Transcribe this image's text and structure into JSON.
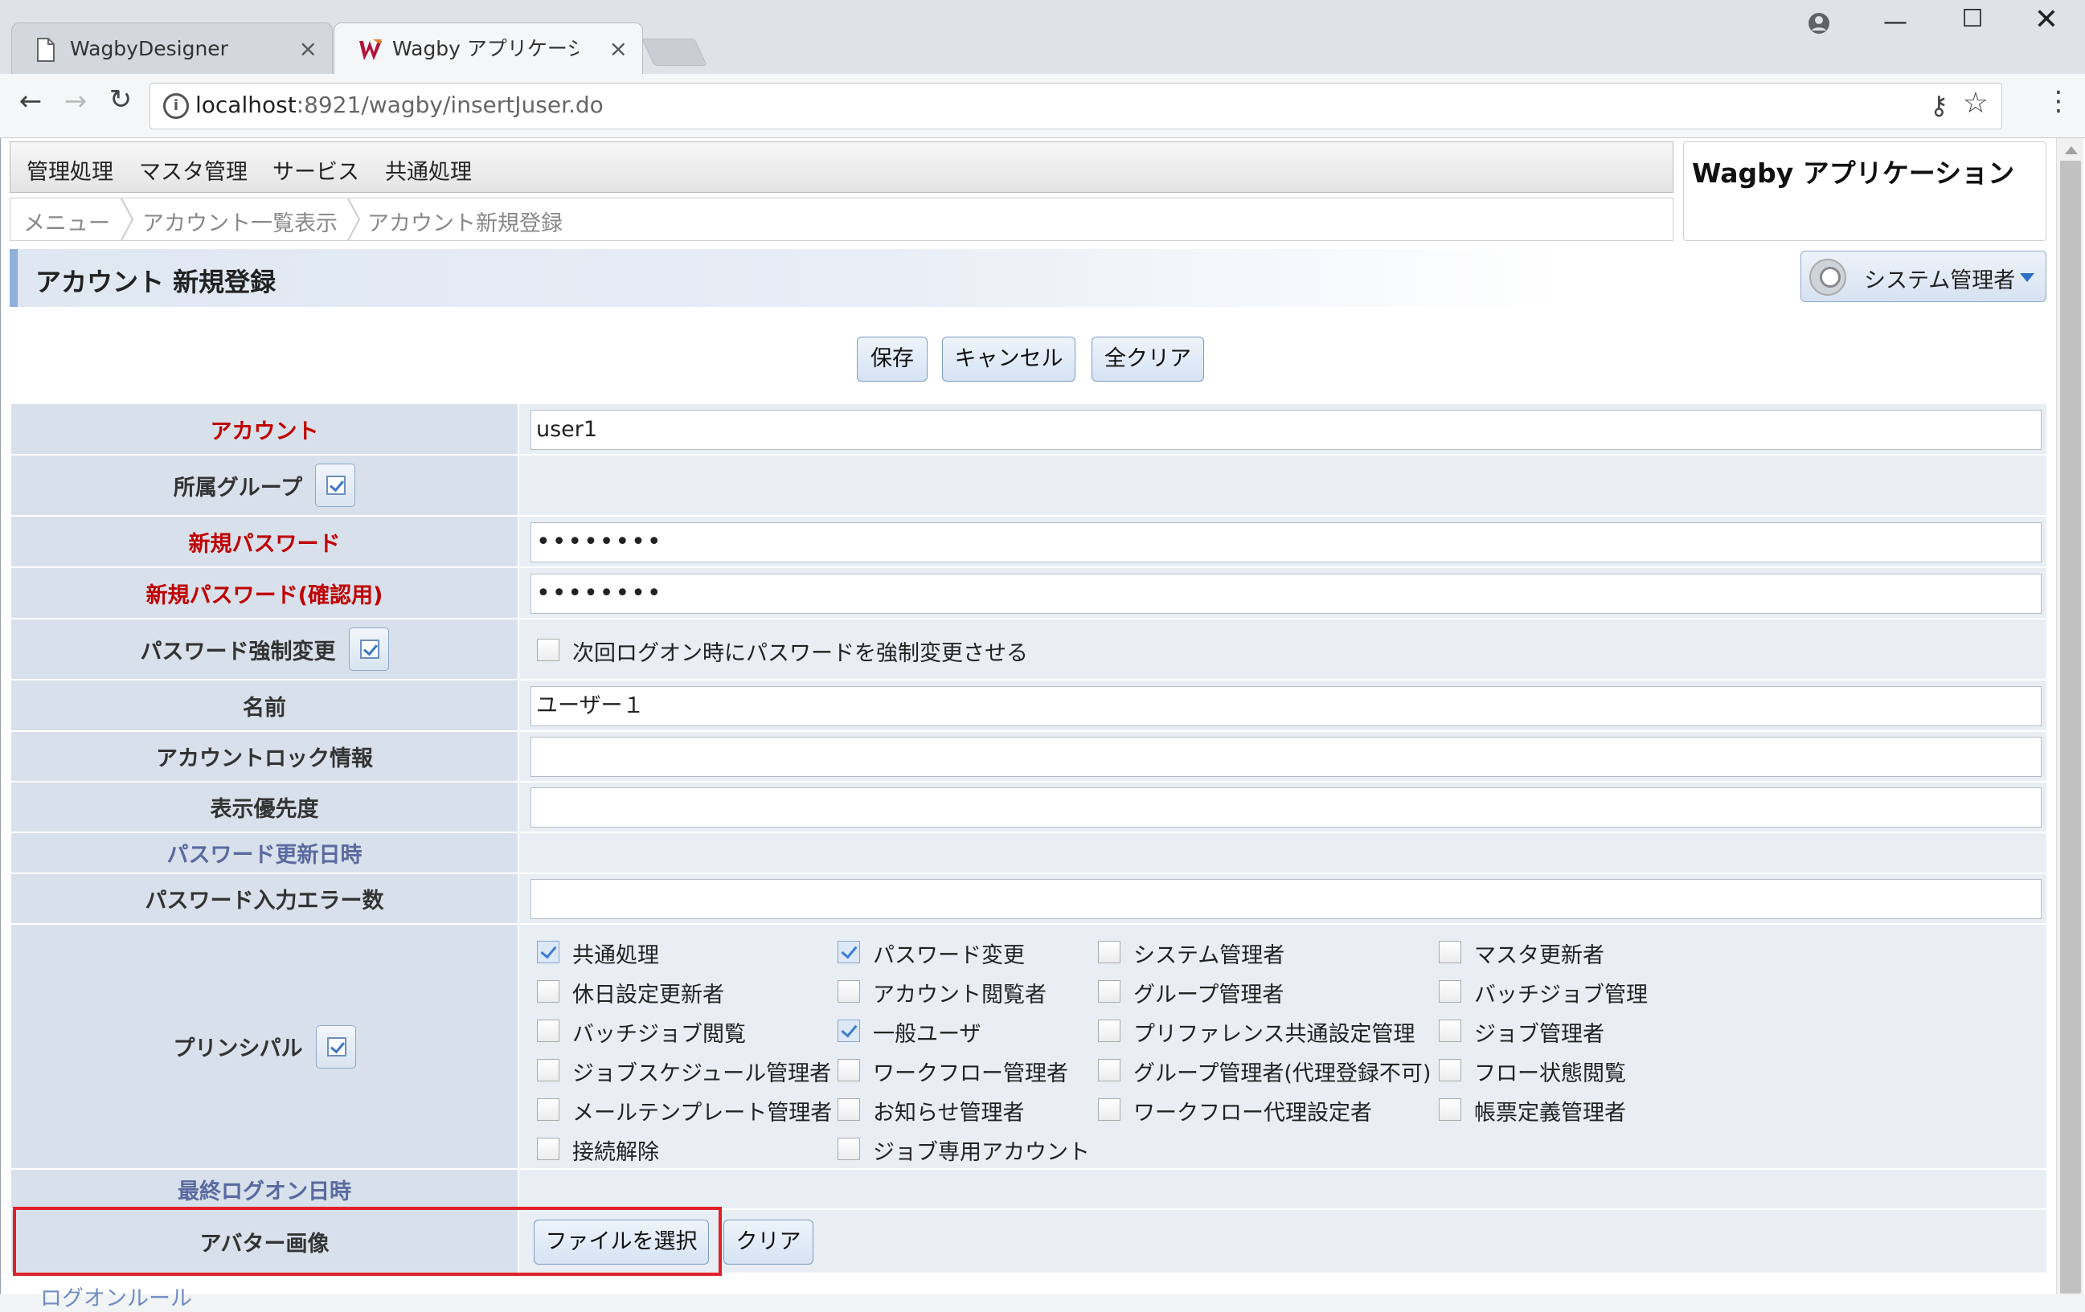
{
  "browser": {
    "tabs": [
      {
        "label": "WagbyDesigner",
        "active": false
      },
      {
        "label": "Wagby アプリケーション アカ",
        "active": true
      }
    ],
    "url_host": "localhost",
    "url_path": ":8921/wagby/insertJuser.do",
    "icons": [
      "back-icon",
      "forward-icon",
      "reload-icon",
      "info-icon",
      "key-icon",
      "star-icon",
      "menu-icon",
      "account-icon",
      "minimize-icon",
      "maximize-icon",
      "close-icon"
    ]
  },
  "menu": [
    "管理処理",
    "マスタ管理",
    "サービス",
    "共通処理"
  ],
  "breadcrumbs": [
    "メニュー",
    "アカウント一覧表示",
    "アカウント新規登録"
  ],
  "app_title": "Wagby アプリケーション",
  "page_title": "アカウント 新規登録",
  "user_menu": "システム管理者",
  "actions": {
    "save": "保存",
    "cancel": "キャンセル",
    "clear_all": "全クリア"
  },
  "fields": {
    "account": {
      "label": "アカウント",
      "value": "user1"
    },
    "group": {
      "label": "所属グループ"
    },
    "new_password": {
      "label": "新規パスワード",
      "value": "••••••••"
    },
    "new_password_confirm": {
      "label": "新規パスワード(確認用)",
      "value": "••••••••"
    },
    "force_change": {
      "label": "パスワード強制変更",
      "option": "次回ログオン時にパスワードを強制変更させる",
      "checked": false
    },
    "name": {
      "label": "名前",
      "value": "ユーザー１"
    },
    "lock_info": {
      "label": "アカウントロック情報",
      "value": ""
    },
    "priority": {
      "label": "表示優先度",
      "value": ""
    },
    "pw_updated": {
      "label": "パスワード更新日時"
    },
    "pw_errors": {
      "label": "パスワード入力エラー数",
      "value": ""
    },
    "principal": {
      "label": "プリンシパル",
      "options": [
        {
          "label": "共通処理",
          "checked": true
        },
        {
          "label": "パスワード変更",
          "checked": true
        },
        {
          "label": "システム管理者",
          "checked": false
        },
        {
          "label": "マスタ更新者",
          "checked": false
        },
        {
          "label": "休日設定更新者",
          "checked": false
        },
        {
          "label": "アカウント閲覧者",
          "checked": false
        },
        {
          "label": "グループ管理者",
          "checked": false
        },
        {
          "label": "バッチジョブ管理",
          "checked": false
        },
        {
          "label": "バッチジョブ閲覧",
          "checked": false
        },
        {
          "label": "一般ユーザ",
          "checked": true
        },
        {
          "label": "プリファレンス共通設定管理",
          "checked": false
        },
        {
          "label": "ジョブ管理者",
          "checked": false
        },
        {
          "label": "ジョブスケジュール管理者",
          "checked": false
        },
        {
          "label": "ワークフロー管理者",
          "checked": false
        },
        {
          "label": "グループ管理者(代理登録不可)",
          "checked": false
        },
        {
          "label": "フロー状態閲覧",
          "checked": false
        },
        {
          "label": "メールテンプレート管理者",
          "checked": false
        },
        {
          "label": "お知らせ管理者",
          "checked": false
        },
        {
          "label": "ワークフロー代理設定者",
          "checked": false
        },
        {
          "label": "帳票定義管理者",
          "checked": false
        },
        {
          "label": "接続解除",
          "checked": false
        },
        {
          "label": "ジョブ専用アカウント",
          "checked": false
        }
      ]
    },
    "last_logon": {
      "label": "最終ログオン日時"
    },
    "avatar": {
      "label": "アバター画像",
      "choose_file": "ファイルを選択",
      "clear": "クリア"
    }
  },
  "cutoff_text": "ログオンルール",
  "colors": {
    "required_label": "#c00000",
    "readonly_label": "#5a6aa0",
    "highlight": "#e0202a",
    "label_bg": "#d8e1eb"
  }
}
